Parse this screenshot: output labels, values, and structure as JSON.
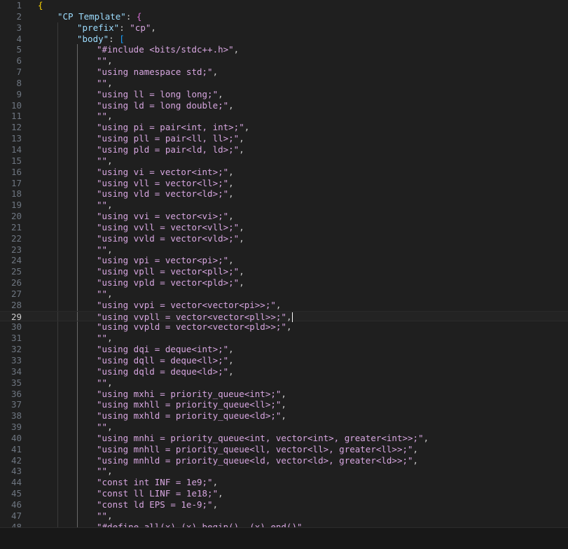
{
  "editor": {
    "colors": {
      "background": "#1f1f1f",
      "line_number": "#6e7681",
      "string": "#d7a6e0",
      "key": "#9cdcfe",
      "bracket_level1": "#ffd700",
      "bracket_level2": "#da70d6",
      "bracket_level3": "#179fff"
    },
    "current_line": 29,
    "lines": [
      {
        "n": "1",
        "indent": 0,
        "tokens": [
          {
            "t": "{",
            "c": "b1"
          }
        ]
      },
      {
        "n": "2",
        "indent": 1,
        "tokens": [
          {
            "t": "\"CP Template\"",
            "c": "kv"
          },
          {
            "t": ": ",
            "c": "p"
          },
          {
            "t": "{",
            "c": "b2"
          }
        ]
      },
      {
        "n": "3",
        "indent": 2,
        "tokens": [
          {
            "t": "\"prefix\"",
            "c": "kv"
          },
          {
            "t": ": ",
            "c": "p"
          },
          {
            "t": "\"cp\"",
            "c": "sv"
          },
          {
            "t": ",",
            "c": "p"
          }
        ]
      },
      {
        "n": "4",
        "indent": 2,
        "tokens": [
          {
            "t": "\"body\"",
            "c": "kv"
          },
          {
            "t": ": ",
            "c": "p"
          },
          {
            "t": "[",
            "c": "b3"
          }
        ]
      },
      {
        "n": "5",
        "indent": 3,
        "tokens": [
          {
            "t": "\"#include <bits/stdc++.h>\"",
            "c": "sv"
          },
          {
            "t": ",",
            "c": "p"
          }
        ]
      },
      {
        "n": "6",
        "indent": 3,
        "tokens": [
          {
            "t": "\"\"",
            "c": "sv"
          },
          {
            "t": ",",
            "c": "p"
          }
        ]
      },
      {
        "n": "7",
        "indent": 3,
        "tokens": [
          {
            "t": "\"using namespace std;\"",
            "c": "sv"
          },
          {
            "t": ",",
            "c": "p"
          }
        ]
      },
      {
        "n": "8",
        "indent": 3,
        "tokens": [
          {
            "t": "\"\"",
            "c": "sv"
          },
          {
            "t": ",",
            "c": "p"
          }
        ]
      },
      {
        "n": "9",
        "indent": 3,
        "tokens": [
          {
            "t": "\"using ll = long long;\"",
            "c": "sv"
          },
          {
            "t": ",",
            "c": "p"
          }
        ]
      },
      {
        "n": "10",
        "indent": 3,
        "tokens": [
          {
            "t": "\"using ld = long double;\"",
            "c": "sv"
          },
          {
            "t": ",",
            "c": "p"
          }
        ]
      },
      {
        "n": "11",
        "indent": 3,
        "tokens": [
          {
            "t": "\"\"",
            "c": "sv"
          },
          {
            "t": ",",
            "c": "p"
          }
        ]
      },
      {
        "n": "12",
        "indent": 3,
        "tokens": [
          {
            "t": "\"using pi = pair<int, int>;\"",
            "c": "sv"
          },
          {
            "t": ",",
            "c": "p"
          }
        ]
      },
      {
        "n": "13",
        "indent": 3,
        "tokens": [
          {
            "t": "\"using pll = pair<ll, ll>;\"",
            "c": "sv"
          },
          {
            "t": ",",
            "c": "p"
          }
        ]
      },
      {
        "n": "14",
        "indent": 3,
        "tokens": [
          {
            "t": "\"using pld = pair<ld, ld>;\"",
            "c": "sv"
          },
          {
            "t": ",",
            "c": "p"
          }
        ]
      },
      {
        "n": "15",
        "indent": 3,
        "tokens": [
          {
            "t": "\"\"",
            "c": "sv"
          },
          {
            "t": ",",
            "c": "p"
          }
        ]
      },
      {
        "n": "16",
        "indent": 3,
        "tokens": [
          {
            "t": "\"using vi = vector<int>;\"",
            "c": "sv"
          },
          {
            "t": ",",
            "c": "p"
          }
        ]
      },
      {
        "n": "17",
        "indent": 3,
        "tokens": [
          {
            "t": "\"using vll = vector<ll>;\"",
            "c": "sv"
          },
          {
            "t": ",",
            "c": "p"
          }
        ]
      },
      {
        "n": "18",
        "indent": 3,
        "tokens": [
          {
            "t": "\"using vld = vector<ld>;\"",
            "c": "sv"
          },
          {
            "t": ",",
            "c": "p"
          }
        ]
      },
      {
        "n": "19",
        "indent": 3,
        "tokens": [
          {
            "t": "\"\"",
            "c": "sv"
          },
          {
            "t": ",",
            "c": "p"
          }
        ]
      },
      {
        "n": "20",
        "indent": 3,
        "tokens": [
          {
            "t": "\"using vvi = vector<vi>;\"",
            "c": "sv"
          },
          {
            "t": ",",
            "c": "p"
          }
        ]
      },
      {
        "n": "21",
        "indent": 3,
        "tokens": [
          {
            "t": "\"using vvll = vector<vll>;\"",
            "c": "sv"
          },
          {
            "t": ",",
            "c": "p"
          }
        ]
      },
      {
        "n": "22",
        "indent": 3,
        "tokens": [
          {
            "t": "\"using vvld = vector<vld>;\"",
            "c": "sv"
          },
          {
            "t": ",",
            "c": "p"
          }
        ]
      },
      {
        "n": "23",
        "indent": 3,
        "tokens": [
          {
            "t": "\"\"",
            "c": "sv"
          },
          {
            "t": ",",
            "c": "p"
          }
        ]
      },
      {
        "n": "24",
        "indent": 3,
        "tokens": [
          {
            "t": "\"using vpi = vector<pi>;\"",
            "c": "sv"
          },
          {
            "t": ",",
            "c": "p"
          }
        ]
      },
      {
        "n": "25",
        "indent": 3,
        "tokens": [
          {
            "t": "\"using vpll = vector<pll>;\"",
            "c": "sv"
          },
          {
            "t": ",",
            "c": "p"
          }
        ]
      },
      {
        "n": "26",
        "indent": 3,
        "tokens": [
          {
            "t": "\"using vpld = vector<pld>;\"",
            "c": "sv"
          },
          {
            "t": ",",
            "c": "p"
          }
        ]
      },
      {
        "n": "27",
        "indent": 3,
        "tokens": [
          {
            "t": "\"\"",
            "c": "sv"
          },
          {
            "t": ",",
            "c": "p"
          }
        ]
      },
      {
        "n": "28",
        "indent": 3,
        "tokens": [
          {
            "t": "\"using vvpi = vector<vector<pi>>;\"",
            "c": "sv"
          },
          {
            "t": ",",
            "c": "p"
          }
        ]
      },
      {
        "n": "29",
        "indent": 3,
        "tokens": [
          {
            "t": "\"using vvpll = vector<vector<pll>>;\"",
            "c": "sv"
          },
          {
            "t": ",",
            "c": "p"
          }
        ],
        "cursor": true
      },
      {
        "n": "30",
        "indent": 3,
        "tokens": [
          {
            "t": "\"using vvpld = vector<vector<pld>>;\"",
            "c": "sv"
          },
          {
            "t": ",",
            "c": "p"
          }
        ]
      },
      {
        "n": "31",
        "indent": 3,
        "tokens": [
          {
            "t": "\"\"",
            "c": "sv"
          },
          {
            "t": ",",
            "c": "p"
          }
        ]
      },
      {
        "n": "32",
        "indent": 3,
        "tokens": [
          {
            "t": "\"using dqi = deque<int>;\"",
            "c": "sv"
          },
          {
            "t": ",",
            "c": "p"
          }
        ]
      },
      {
        "n": "33",
        "indent": 3,
        "tokens": [
          {
            "t": "\"using dqll = deque<ll>;\"",
            "c": "sv"
          },
          {
            "t": ",",
            "c": "p"
          }
        ]
      },
      {
        "n": "34",
        "indent": 3,
        "tokens": [
          {
            "t": "\"using dqld = deque<ld>;\"",
            "c": "sv"
          },
          {
            "t": ",",
            "c": "p"
          }
        ]
      },
      {
        "n": "35",
        "indent": 3,
        "tokens": [
          {
            "t": "\"\"",
            "c": "sv"
          },
          {
            "t": ",",
            "c": "p"
          }
        ]
      },
      {
        "n": "36",
        "indent": 3,
        "tokens": [
          {
            "t": "\"using mxhi = priority_queue<int>;\"",
            "c": "sv"
          },
          {
            "t": ",",
            "c": "p"
          }
        ]
      },
      {
        "n": "37",
        "indent": 3,
        "tokens": [
          {
            "t": "\"using mxhll = priority_queue<ll>;\"",
            "c": "sv"
          },
          {
            "t": ",",
            "c": "p"
          }
        ]
      },
      {
        "n": "38",
        "indent": 3,
        "tokens": [
          {
            "t": "\"using mxhld = priority_queue<ld>;\"",
            "c": "sv"
          },
          {
            "t": ",",
            "c": "p"
          }
        ]
      },
      {
        "n": "39",
        "indent": 3,
        "tokens": [
          {
            "t": "\"\"",
            "c": "sv"
          },
          {
            "t": ",",
            "c": "p"
          }
        ]
      },
      {
        "n": "40",
        "indent": 3,
        "tokens": [
          {
            "t": "\"using mnhi = priority_queue<int, vector<int>, greater<int>>;\"",
            "c": "sv"
          },
          {
            "t": ",",
            "c": "p"
          }
        ]
      },
      {
        "n": "41",
        "indent": 3,
        "tokens": [
          {
            "t": "\"using mnhll = priority_queue<ll, vector<ll>, greater<ll>>;\"",
            "c": "sv"
          },
          {
            "t": ",",
            "c": "p"
          }
        ]
      },
      {
        "n": "42",
        "indent": 3,
        "tokens": [
          {
            "t": "\"using mnhld = priority_queue<ld, vector<ld>, greater<ld>>;\"",
            "c": "sv"
          },
          {
            "t": ",",
            "c": "p"
          }
        ]
      },
      {
        "n": "43",
        "indent": 3,
        "tokens": [
          {
            "t": "\"\"",
            "c": "sv"
          },
          {
            "t": ",",
            "c": "p"
          }
        ]
      },
      {
        "n": "44",
        "indent": 3,
        "tokens": [
          {
            "t": "\"const int INF = 1e9;\"",
            "c": "sv"
          },
          {
            "t": ",",
            "c": "p"
          }
        ]
      },
      {
        "n": "45",
        "indent": 3,
        "tokens": [
          {
            "t": "\"const ll LINF = 1e18;\"",
            "c": "sv"
          },
          {
            "t": ",",
            "c": "p"
          }
        ]
      },
      {
        "n": "46",
        "indent": 3,
        "tokens": [
          {
            "t": "\"const ld EPS = 1e-9;\"",
            "c": "sv"
          },
          {
            "t": ",",
            "c": "p"
          }
        ]
      },
      {
        "n": "47",
        "indent": 3,
        "tokens": [
          {
            "t": "\"\"",
            "c": "sv"
          },
          {
            "t": ",",
            "c": "p"
          }
        ]
      },
      {
        "n": "48",
        "indent": 3,
        "tokens": [
          {
            "t": "\"#define all(x) (x).begin(), (x).end()\"",
            "c": "sv"
          },
          {
            "t": ",",
            "c": "p"
          }
        ]
      }
    ]
  }
}
